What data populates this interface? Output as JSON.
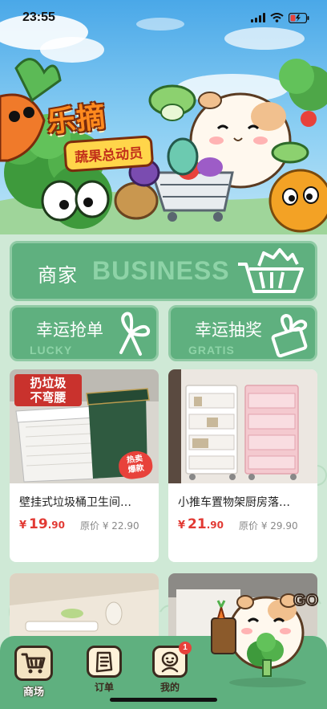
{
  "status_bar": {
    "time": "23:55"
  },
  "hero": {
    "logo_main": "乐摘",
    "logo_sub": "蔬果总动员"
  },
  "business_card": {
    "title_cn": "商家",
    "title_en": "BUSINESS"
  },
  "lucky_cards": [
    {
      "title_cn": "幸运抢单",
      "title_en": "LUCKY"
    },
    {
      "title_cn": "幸运抽奖",
      "title_en": "GRATIS"
    }
  ],
  "products": [
    {
      "name": "壁挂式垃圾桶卫生间…",
      "price_currency": "¥",
      "price_int": "19",
      "price_dec": ".90",
      "original_price": "原价 ¥ 22.90",
      "image_badge": "扔垃圾\n不弯腰",
      "hot_badge": "热卖\n爆款"
    },
    {
      "name": "小推车置物架厨房落…",
      "price_currency": "¥",
      "price_int": "21",
      "price_dec": ".90",
      "original_price": "原价 ¥ 29.90"
    }
  ],
  "mascot": {
    "label": "GO"
  },
  "tab_bar": {
    "items": [
      {
        "label": "商场",
        "icon": "cart-icon",
        "active": true
      },
      {
        "label": "订单",
        "icon": "order-list-icon",
        "active": false
      },
      {
        "label": "我的",
        "icon": "profile-icon",
        "active": false,
        "badge": "1"
      }
    ]
  },
  "colors": {
    "accent_green": "#5fb07f",
    "background_green": "#cfe9d6",
    "price_red": "#e23a34"
  }
}
